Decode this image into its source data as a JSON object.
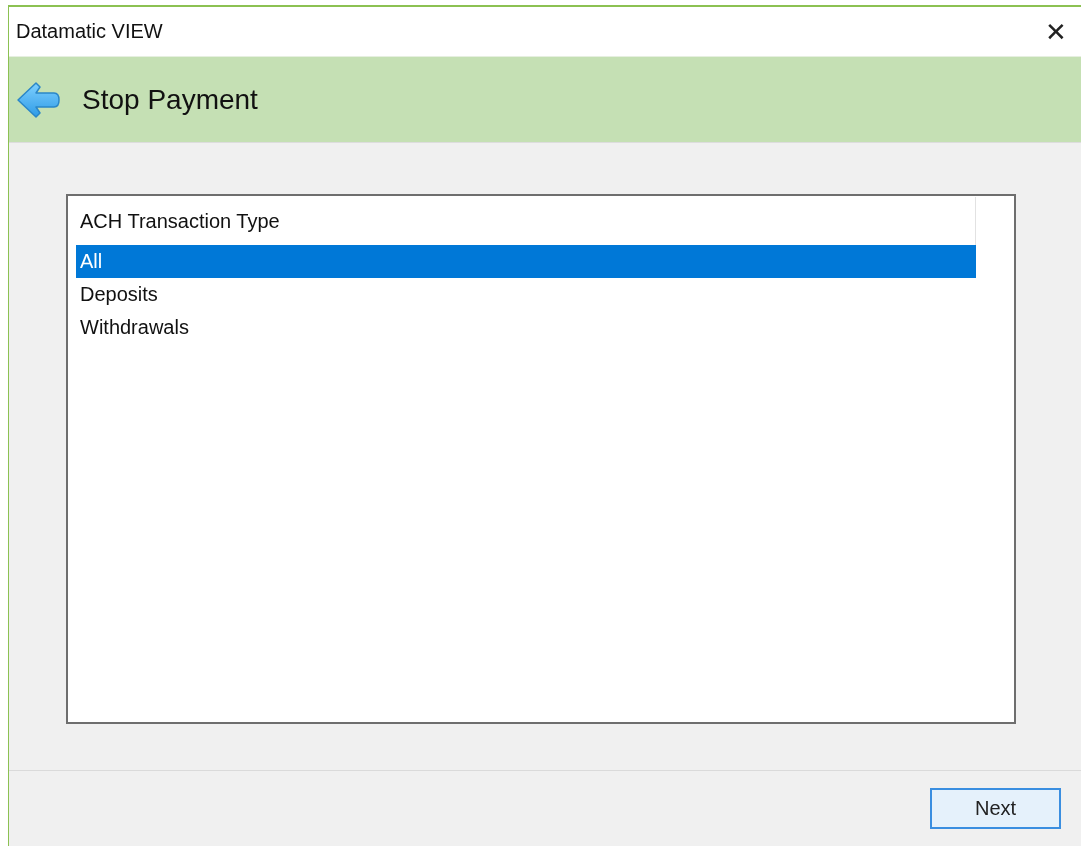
{
  "window": {
    "title": "Datamatic VIEW",
    "close": "✕"
  },
  "header": {
    "title": "Stop Payment"
  },
  "list": {
    "column": "ACH Transaction Type",
    "items": [
      {
        "label": "All",
        "selected": true
      },
      {
        "label": "Deposits",
        "selected": false
      },
      {
        "label": "Withdrawals",
        "selected": false
      }
    ]
  },
  "buttons": [
    "Next"
  ]
}
